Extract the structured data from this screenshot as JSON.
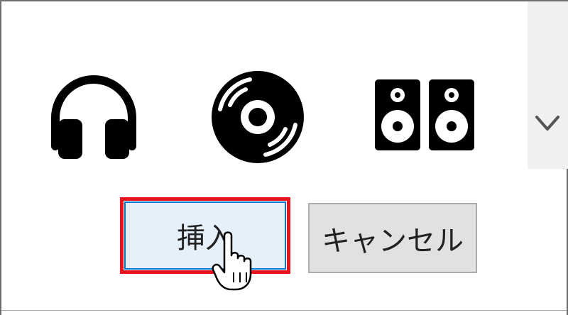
{
  "icons": [
    {
      "name": "headphones-icon"
    },
    {
      "name": "vinyl-disc-icon"
    },
    {
      "name": "speakers-icon"
    }
  ],
  "scrollbar": {
    "down_icon": "chevron-down-icon"
  },
  "buttons": {
    "insert_label": "挿入",
    "cancel_label": "キャンセル"
  },
  "colors": {
    "highlight_border": "#e8141c",
    "focus_border": "#0078d7",
    "insert_background": "#e6f0fa",
    "cancel_background": "#e1e1e1"
  },
  "cursor": "hand-pointer-icon"
}
